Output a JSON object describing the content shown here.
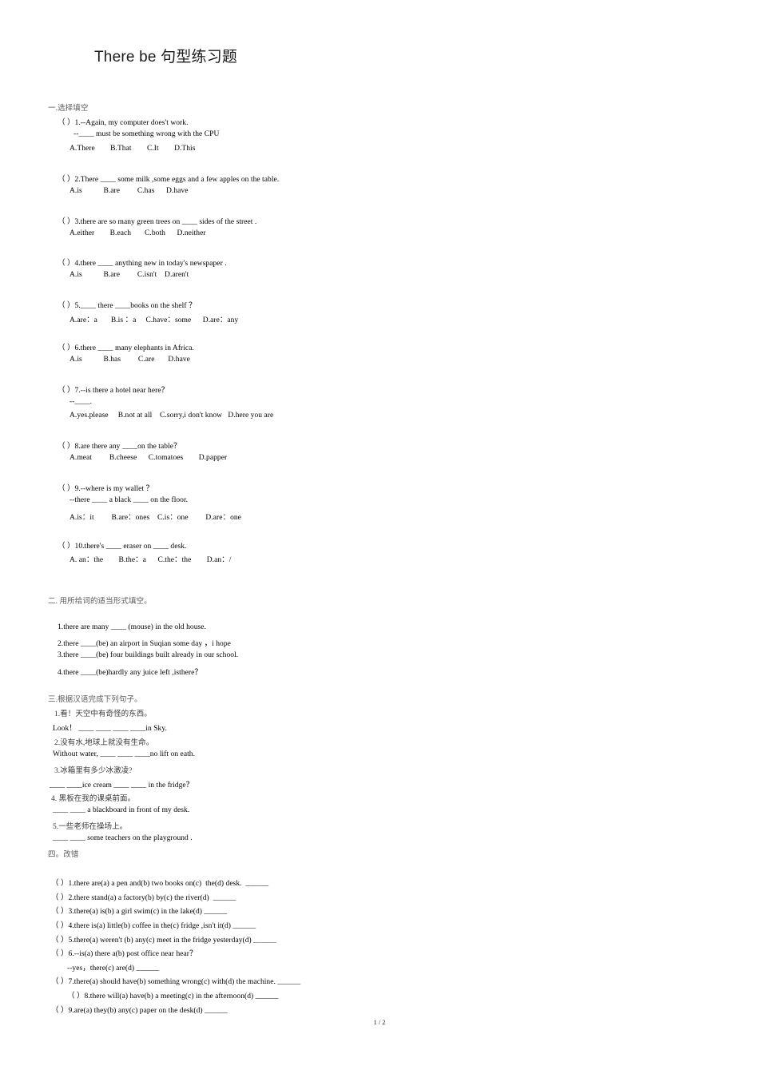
{
  "document": {
    "title": "There be 句型练习题",
    "footer": "1 / 2"
  },
  "section_one": {
    "heading": "一.选择填空",
    "questions": [
      {
        "stem": "（ ）1.--Again, my computer does't work.",
        "stem2": "--____ must be something wrong with the CPU",
        "options": "A.There        B.That        C.It        D.This"
      },
      {
        "stem": "（ ）2.There ____ some milk ,some eggs and a few apples on the table.",
        "options": "A.is           B.are         C.has      D.have"
      },
      {
        "stem": "（ ）3.there are so many green trees on ____ sides of the street .",
        "options": "A.either        B.each       C.both      D.neither"
      },
      {
        "stem": "（ ）4.there ____ anything new in today's newspaper .",
        "options": "A.is           B.are         C.isn't    D.aren't"
      },
      {
        "stem": "（ ）5.____ there ____books on the shelf ？",
        "options": "A.are：a       B.is ：a     C.have：some      D.are：any"
      },
      {
        "stem": "（ ）6.there ____ many elephants in Africa.",
        "options": "A.is           B.has         C.are       D.have"
      },
      {
        "stem": "（ ）7.--is there a hotel near here？",
        "stem2": "--____.",
        "options": "A.yes.please     B.not at all    C.sorry,i don't know   D.here you are"
      },
      {
        "stem": "（ ）8.are there any ____on the table？",
        "options": "A.meat         B.cheese      C.tomatoes        D.papper"
      },
      {
        "stem": "（ ）9.--where is my wallet ？",
        "stem2": "--there ____ a black ____ on the floor.",
        "options": "A.is：it         B.are：ones    C.is：one         D.are：one"
      },
      {
        "stem": "（ ）10.there's ____ eraser on ____ desk.",
        "options": "A. an：the        B.the：a      C.the：the        D.an：/"
      }
    ]
  },
  "section_two": {
    "heading": "二. 用所给词的适当形式填空。",
    "items": [
      "1.there are many ____ (mouse) in the old house.",
      "2.there ____(be) an airport in Suqian some day ，i hope",
      "3.there ____(be) four buildings built already in our school.",
      "4.there ____(be)hardly any juice left ,isthere？"
    ]
  },
  "section_three": {
    "heading": "三.根据汉语完成下列句子。",
    "items": [
      "1.看！天空中有奇怪的东西。",
      "Look！ ____ ____ ____ ____in Sky.",
      "2.没有水,地球上就没有生命。",
      "Without water, ____ ____ ____no lift on eath.",
      "3.冰箱里有多少冰激凌?",
      "____ ____ice cream ____ ____ in the fridge？",
      "4. 黑板在我的课桌前面。",
      "____ ____ a blackboard in front of my desk.",
      "5.一些老师在操场上。",
      "____ ____ some teachers on the playground ."
    ]
  },
  "section_four": {
    "heading": "四。改错",
    "items": [
      "（ ）1.there are(a) a pen and(b) two books on(c)  the(d) desk.  ______",
      "（ ）2.there stand(a) a factory(b) by(c) the river(d)  ______",
      "（ ）3.there(a) is(b) a girl swim(c) in the lake(d) ______",
      "（ ）4.there is(a) little(b) coffee in the(c) fridge ,isn't it(d) ______",
      "（ ）5.there(a) weren't (b) any(c) meet in the fridge yesterday(d) ＿＿＿",
      "（ ）6.--is(a) there a(b) post office near hear？",
      "--yes，there(c) are(d) ______",
      "（ ）7.there(a) should have(b) something wrong(c) with(d) the machine. ______",
      "（ ）8.there will(a) have(b) a meeting(c) in the afternoon(d) ______",
      "（ ）9.are(a) they(b) any(c) paper on the desk(d) ______"
    ]
  }
}
